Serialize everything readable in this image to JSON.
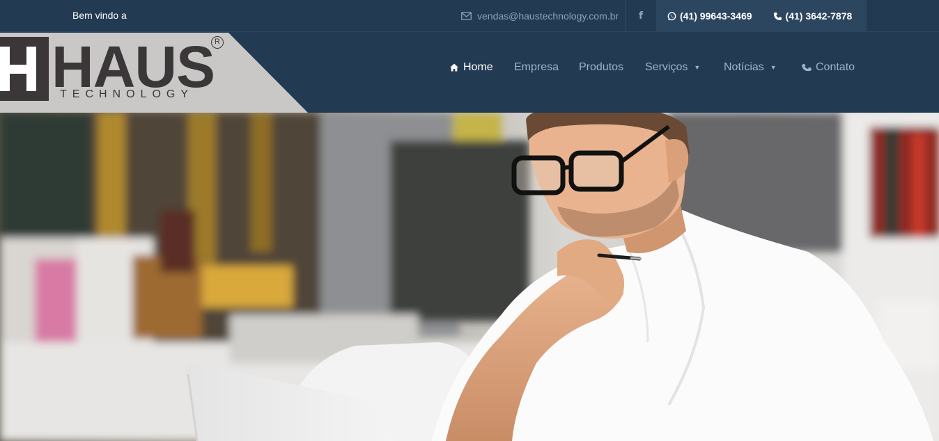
{
  "topbar": {
    "welcome": "Bem vindo a",
    "email": "vendas@haustechnology.com.br",
    "facebook_icon": "facebook-icon",
    "phone_whatsapp": "(41) 99643-3469",
    "phone_landline": "(41) 3642-7878"
  },
  "logo": {
    "name": "HAUS",
    "tagline": "TECHNOLOGY",
    "registered": "R"
  },
  "nav": {
    "items": [
      {
        "label": "Home",
        "icon": "home-icon",
        "active": true
      },
      {
        "label": "Empresa"
      },
      {
        "label": "Produtos"
      },
      {
        "label": "Serviços",
        "dropdown": true
      },
      {
        "label": "Notícias",
        "dropdown": true
      },
      {
        "label": "Contato",
        "icon": "phone-icon"
      }
    ]
  },
  "colors": {
    "header_bg": "#233a53",
    "phones_bg": "#2c4660",
    "logo_panel": "#c9c8c7",
    "logo_text": "#3b3738"
  }
}
